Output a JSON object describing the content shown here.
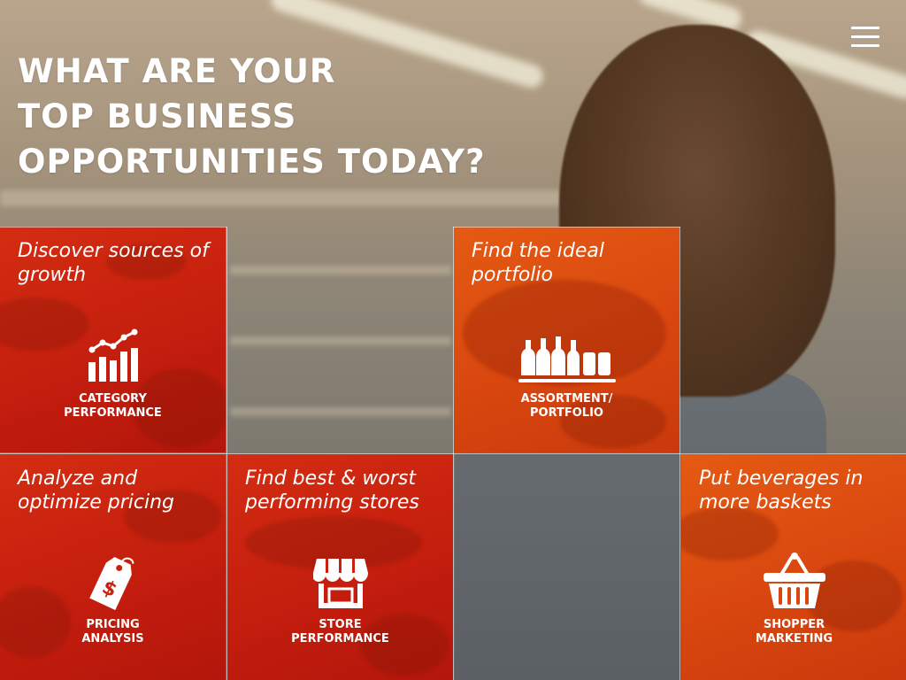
{
  "headline": {
    "lines": [
      "WHAT ARE YOUR",
      "TOP BUSINESS",
      "OPPORTUNITIES TODAY?"
    ]
  },
  "menu": {
    "icon": "hamburger-menu-icon"
  },
  "tiles": [
    {
      "title": "Discover sources of growth",
      "label": "CATEGORY\nPERFORMANCE",
      "icon": "bar-chart-trend-icon",
      "color": "#c8220f"
    },
    {
      "title": "Find the ideal portfolio",
      "label": "ASSORTMENT/\nPORTFOLIO",
      "icon": "bottles-shelf-icon",
      "color": "#dc4e11"
    },
    {
      "title": "Analyze and optimize pricing",
      "label": "PRICING\nANALYSIS",
      "icon": "price-tag-icon",
      "color": "#c8220f"
    },
    {
      "title": "Find best & worst performing stores",
      "label": "STORE\nPERFORMANCE",
      "icon": "storefront-icon",
      "color": "#c8220f"
    },
    {
      "title": "Put beverages in more baskets",
      "label": "SHOPPER\nMARKETING",
      "icon": "shopping-basket-icon",
      "color": "#dc4e11"
    }
  ]
}
